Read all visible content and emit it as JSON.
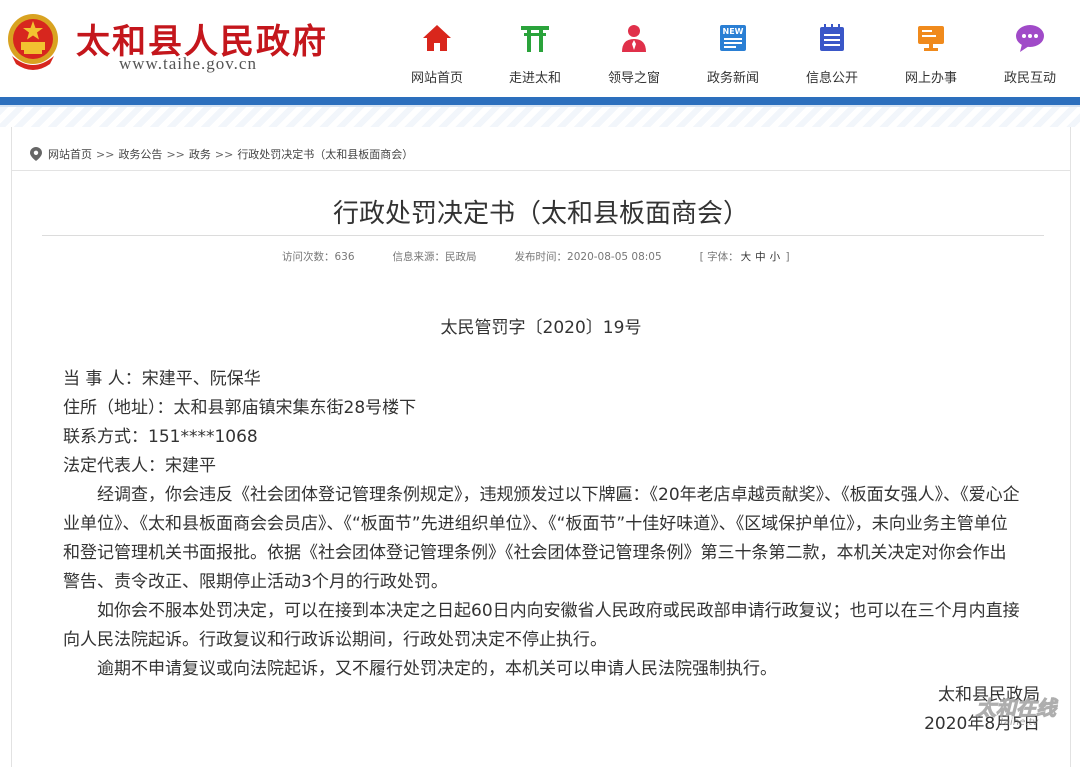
{
  "site": {
    "title": "太和县人民政府",
    "url": "www.taihe.gov.cn"
  },
  "nav": {
    "items": [
      {
        "label": "网站首页",
        "icon": "home-icon"
      },
      {
        "label": "走进太和",
        "icon": "gate-icon"
      },
      {
        "label": "领导之窗",
        "icon": "leader-icon"
      },
      {
        "label": "政务新闻",
        "icon": "news-icon"
      },
      {
        "label": "信息公开",
        "icon": "info-list-icon"
      },
      {
        "label": "网上办事",
        "icon": "online-service-icon"
      },
      {
        "label": "政民互动",
        "icon": "chat-icon"
      }
    ],
    "colors": {
      "home": "#d9261c",
      "gate": "#2aa33b",
      "leader": "#e0304a",
      "news": "#2a7fd4",
      "info": "#3a57c8",
      "service": "#f08a1c",
      "chat": "#a04ac8"
    }
  },
  "breadcrumb": {
    "items": [
      "网站首页",
      "政务公告",
      "政务",
      "行政处罚决定书（太和县板面商会）"
    ],
    "separator": ">>"
  },
  "article": {
    "title": "行政处罚决定书（太和县板面商会）",
    "meta": {
      "views_label": "访问次数：",
      "views": "636",
      "source_label": "信息来源：",
      "source": "民政局",
      "date_label": "发布时间：",
      "date": "2020-08-05 08:05",
      "font_label": "[ 字体：",
      "font_large": "大",
      "font_medium": "中",
      "font_small": "小",
      "font_close": " ]"
    },
    "doc_number": "太民管罚字〔2020〕19号",
    "lines": [
      "当 事 人：宋建平、阮保华",
      "住所（地址）：太和县郭庙镇宋集东街28号楼下",
      "联系方式：151****1068",
      "法定代表人：宋建平"
    ],
    "paragraphs": [
      "经调查，你会违反《社会团体登记管理条例规定》，违规颁发过以下牌匾：《20年老店卓越贡献奖》、《板面女强人》、《爱心企业单位》、《太和县板面商会会员店》、《“板面节”先进组织单位》、《“板面节”十佳好味道》、《区域保护单位》，未向业务主管单位和登记管理机关书面报批。依据《社会团体登记管理条例》《社会团体登记管理条例》第三十条第二款，本机关决定对你会作出警告、责令改正、限期停止活动3个月的行政处罚。",
      "如你会不服本处罚决定，可以在接到本决定之日起60日内向安徽省人民政府或民政部申请行政复议；也可以在三个月内直接向人民法院起诉。行政复议和行政诉讼期间，行政处罚决定不停止执行。",
      "逾期不申请复议或向法院起诉，又不履行处罚决定的，本机关可以申请人民法院强制执行。"
    ],
    "signature": "太和县民政局",
    "sign_date": "2020年8月5日"
  },
  "watermark": {
    "text": "太和在线",
    "sub": "taihe.tv"
  },
  "colors": {
    "brand_red": "#c4161c",
    "band_blue": "#2c6fbd"
  }
}
